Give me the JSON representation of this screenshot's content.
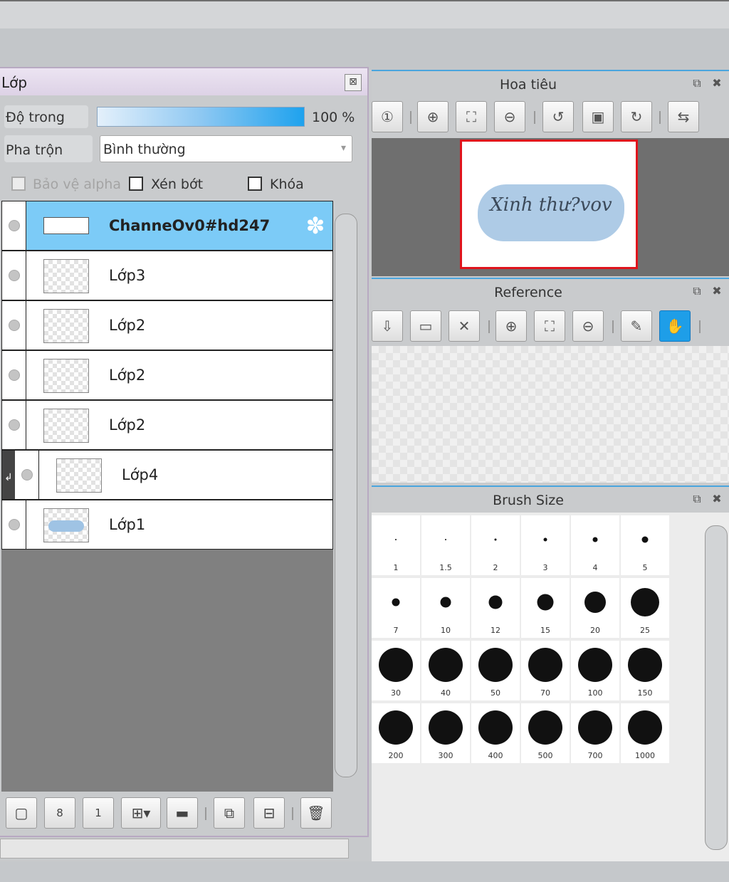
{
  "layer_panel": {
    "title": "Lớp",
    "close_icon": "close-icon",
    "opacity_label": "Độ trong",
    "opacity_value": "100 %",
    "opacity_level": 1.0,
    "blend_label": "Pha trộn",
    "blend_value": "Bình thường",
    "checkboxes": [
      {
        "label": "Bảo vệ alpha",
        "checked": false,
        "disabled": true
      },
      {
        "label": "Xén bớt",
        "checked": false,
        "disabled": false
      },
      {
        "label": "Khóa",
        "checked": false,
        "disabled": false
      }
    ],
    "layers": [
      {
        "name": "ChanneOv0#hd247",
        "selected": true,
        "clipped": false
      },
      {
        "name": "Lớp3",
        "selected": false,
        "clipped": false
      },
      {
        "name": "Lớp2",
        "selected": false,
        "clipped": false
      },
      {
        "name": "Lớp2",
        "selected": false,
        "clipped": false
      },
      {
        "name": "Lớp2",
        "selected": false,
        "clipped": false
      },
      {
        "name": "Lớp4",
        "selected": false,
        "clipped": true
      },
      {
        "name": "Lớp1",
        "selected": false,
        "clipped": false
      }
    ],
    "toolbar": [
      "new-layer-icon",
      "new-8bit-layer-icon",
      "new-1bit-layer-icon",
      "new-layer-menu-icon",
      "new-folder-icon",
      "duplicate-layer-icon",
      "merge-layer-icon",
      "delete-layer-icon"
    ]
  },
  "navigator": {
    "title": "Hoa tiêu",
    "canvas_text": "Xinh thư?vov",
    "tools": [
      "zoom-actual-icon",
      "zoom-in-icon",
      "fit-icon",
      "zoom-out-icon",
      "rotate-left-icon",
      "fit-window-icon",
      "rotate-right-icon",
      "flip-icon"
    ]
  },
  "reference": {
    "title": "Reference",
    "tools": [
      "load-icon",
      "open-folder-icon",
      "clear-icon",
      "zoom-in-icon",
      "fit-icon",
      "zoom-out-icon",
      "eyedropper-icon",
      "hand-icon"
    ]
  },
  "brush_size": {
    "title": "Brush Size",
    "sizes": [
      "1",
      "1.5",
      "2",
      "3",
      "4",
      "5",
      "7",
      "10",
      "12",
      "15",
      "20",
      "25",
      "30",
      "40",
      "50",
      "70",
      "100",
      "150",
      "200",
      "300",
      "400",
      "500",
      "700",
      "1000"
    ]
  }
}
